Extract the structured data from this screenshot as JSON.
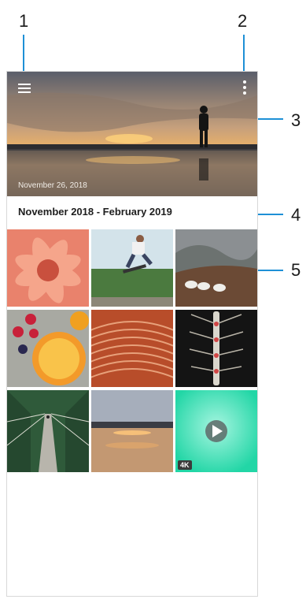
{
  "callouts": [
    "1",
    "2",
    "3",
    "4",
    "5"
  ],
  "header": {
    "menu_icon": "hamburger-menu-icon",
    "more_icon": "more-vertical-icon"
  },
  "hero": {
    "date": "November 26, 2018"
  },
  "section": {
    "title": "November 2018 - February 2019"
  },
  "thumbnails": [
    {
      "name": "flower"
    },
    {
      "name": "skateboarder"
    },
    {
      "name": "sheep-in-hills"
    },
    {
      "name": "fruit"
    },
    {
      "name": "basket-weave"
    },
    {
      "name": "rowing-boat"
    },
    {
      "name": "rope-bridge"
    },
    {
      "name": "sunset-lake"
    },
    {
      "name": "video",
      "badge": "4K"
    }
  ],
  "colors": {
    "accent": "#1e90d6",
    "video_bg": "#3fe0c0"
  }
}
